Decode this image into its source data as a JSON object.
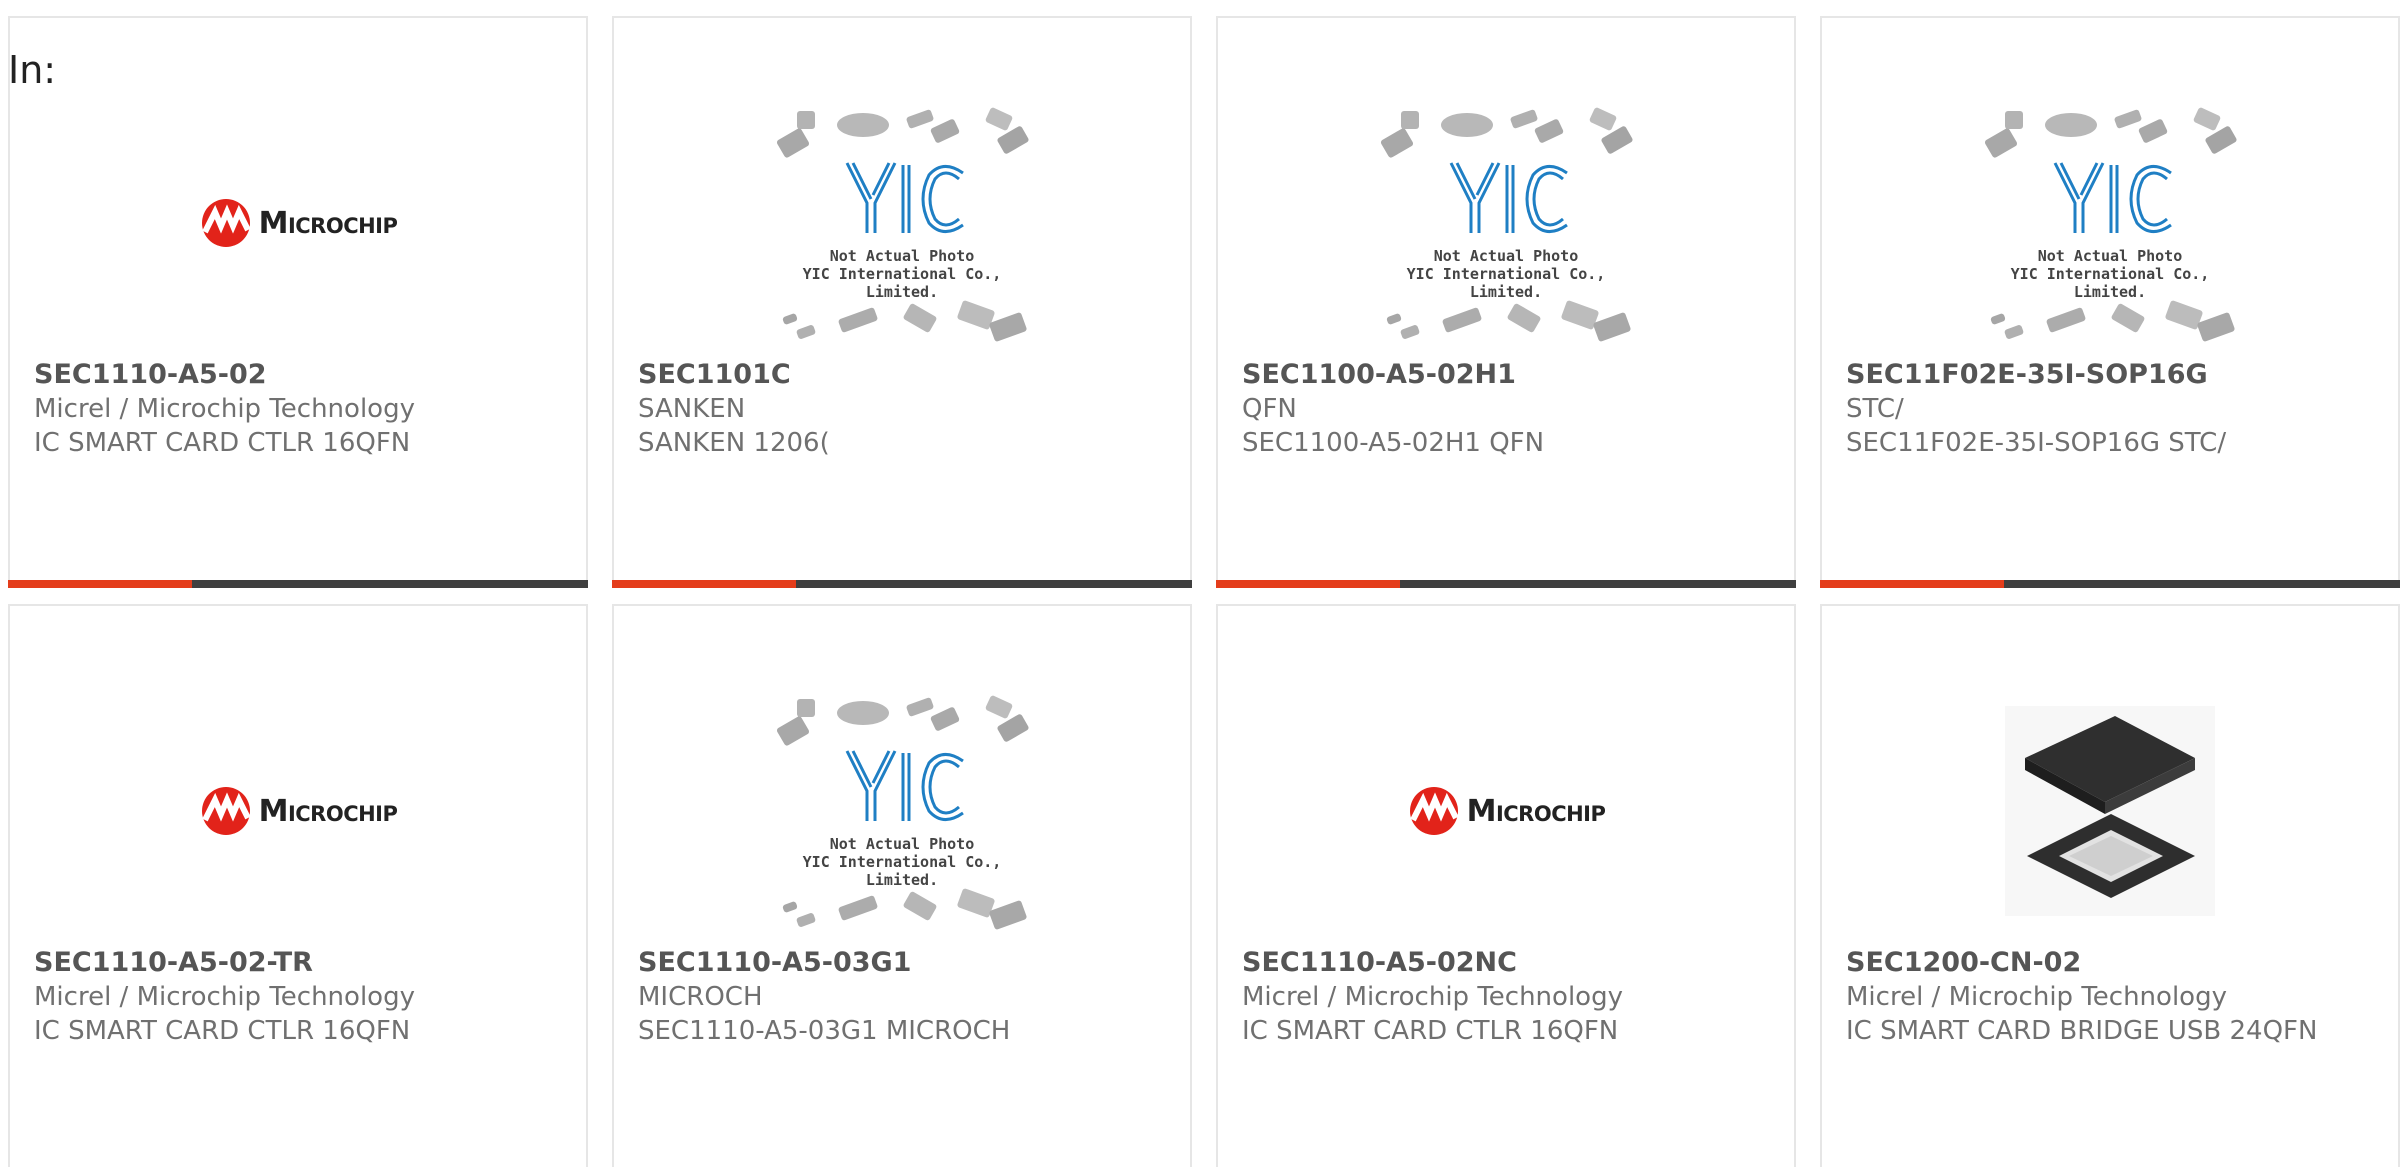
{
  "search": {
    "prefix": "In:"
  },
  "cards": [
    {
      "part": "SEC1110-A5-02",
      "maker": "Micrel / Microchip Technology",
      "desc": "IC SMART CARD CTLR 16QFN",
      "image": "microchip-logo",
      "logo_text": "Microchip"
    },
    {
      "part": "SEC1101C",
      "maker": "SANKEN",
      "desc": "SANKEN 1206(",
      "image": "yic-placeholder",
      "yic_caption": [
        "Not Actual Photo",
        "YIC International Co., Limited."
      ]
    },
    {
      "part": "SEC1100-A5-02H1",
      "maker": "QFN",
      "desc": "SEC1100-A5-02H1 QFN",
      "image": "yic-placeholder",
      "yic_caption": [
        "Not Actual Photo",
        "YIC International Co., Limited."
      ]
    },
    {
      "part": "SEC11F02E-35I-SOP16G",
      "maker": "STC/",
      "desc": "SEC11F02E-35I-SOP16G STC/",
      "image": "yic-placeholder",
      "yic_caption": [
        "Not Actual Photo",
        "YIC International Co., Limited."
      ]
    },
    {
      "part": "SEC1110-A5-02-TR",
      "maker": "Micrel / Microchip Technology",
      "desc": "IC SMART CARD CTLR 16QFN",
      "image": "microchip-logo",
      "logo_text": "Microchip"
    },
    {
      "part": "SEC1110-A5-03G1",
      "maker": "MICROCH",
      "desc": "SEC1110-A5-03G1 MICROCH",
      "image": "yic-placeholder",
      "yic_caption": [
        "Not Actual Photo",
        "YIC International Co., Limited."
      ]
    },
    {
      "part": "SEC1110-A5-02NC",
      "maker": "Micrel / Microchip Technology",
      "desc": "IC SMART CARD CTLR 16QFN",
      "image": "microchip-logo",
      "logo_text": "Microchip"
    },
    {
      "part": "SEC1200-CN-02",
      "maker": "Micrel / Microchip Technology",
      "desc": "IC SMART CARD BRIDGE USB 24QFN",
      "image": "qfn-chip-photo"
    }
  ],
  "colors": {
    "accent": "#e43d1b",
    "bar": "#3f3f3f",
    "border": "#e6e6e6",
    "microchip_red": "#e2231a",
    "yic_blue": "#1f7fc4"
  }
}
